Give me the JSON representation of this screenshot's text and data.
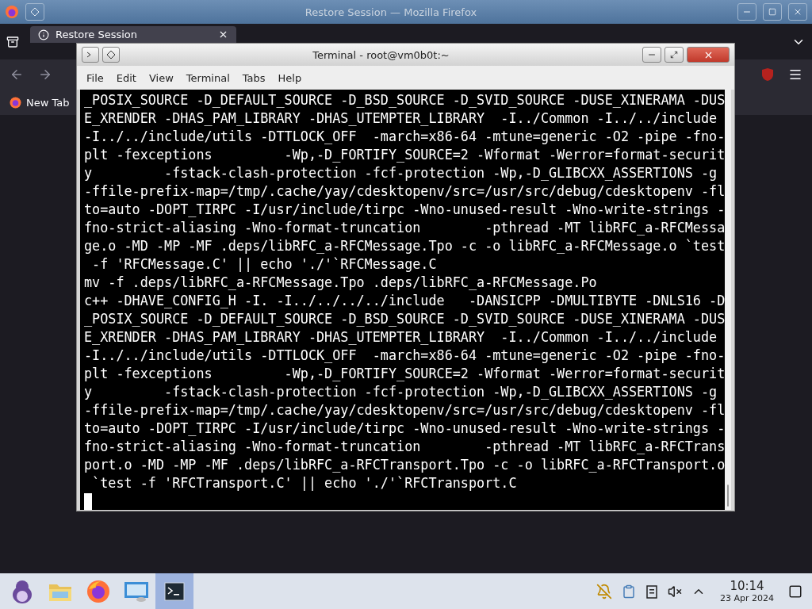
{
  "browser": {
    "title": "Restore Session — Mozilla Firefox",
    "tabs": [
      {
        "label": "Restore Session",
        "selected": true
      }
    ],
    "bookmarks": [
      "New Tab"
    ]
  },
  "terminal": {
    "title": "Terminal - root@vm0b0t:~",
    "menu": [
      "File",
      "Edit",
      "View",
      "Terminal",
      "Tabs",
      "Help"
    ],
    "lines": [
      "_POSIX_SOURCE -D_DEFAULT_SOURCE -D_BSD_SOURCE -D_SVID_SOURCE -DUSE_XINERAMA -DUS",
      "E_XRENDER -DHAS_PAM_LIBRARY -DHAS_UTEMPTER_LIBRARY  -I../Common -I../../include",
      "-I../../include/utils -DTTLOCK_OFF  -march=x86-64 -mtune=generic -O2 -pipe -fno-",
      "plt -fexceptions         -Wp,-D_FORTIFY_SOURCE=2 -Wformat -Werror=format-securit",
      "y         -fstack-clash-protection -fcf-protection -Wp,-D_GLIBCXX_ASSERTIONS -g",
      "-ffile-prefix-map=/tmp/.cache/yay/cdesktopenv/src=/usr/src/debug/cdesktopenv -fl",
      "to=auto -DOPT_TIRPC -I/usr/include/tirpc -Wno-unused-result -Wno-write-strings -",
      "fno-strict-aliasing -Wno-format-truncation        -pthread -MT libRFC_a-RFCMessa",
      "ge.o -MD -MP -MF .deps/libRFC_a-RFCMessage.Tpo -c -o libRFC_a-RFCMessage.o `test",
      " -f 'RFCMessage.C' || echo './'`RFCMessage.C",
      "mv -f .deps/libRFC_a-RFCMessage.Tpo .deps/libRFC_a-RFCMessage.Po",
      "c++ -DHAVE_CONFIG_H -I. -I../../../../include   -DANSICPP -DMULTIBYTE -DNLS16 -D",
      "_POSIX_SOURCE -D_DEFAULT_SOURCE -D_BSD_SOURCE -D_SVID_SOURCE -DUSE_XINERAMA -DUS",
      "E_XRENDER -DHAS_PAM_LIBRARY -DHAS_UTEMPTER_LIBRARY  -I../Common -I../../include",
      "-I../../include/utils -DTTLOCK_OFF  -march=x86-64 -mtune=generic -O2 -pipe -fno-",
      "plt -fexceptions         -Wp,-D_FORTIFY_SOURCE=2 -Wformat -Werror=format-securit",
      "y         -fstack-clash-protection -fcf-protection -Wp,-D_GLIBCXX_ASSERTIONS -g",
      "-ffile-prefix-map=/tmp/.cache/yay/cdesktopenv/src=/usr/src/debug/cdesktopenv -fl",
      "to=auto -DOPT_TIRPC -I/usr/include/tirpc -Wno-unused-result -Wno-write-strings -",
      "fno-strict-aliasing -Wno-format-truncation        -pthread -MT libRFC_a-RFCTrans",
      "port.o -MD -MP -MF .deps/libRFC_a-RFCTransport.Tpo -c -o libRFC_a-RFCTransport.o",
      " `test -f 'RFCTransport.C' || echo './'`RFCTransport.C"
    ]
  },
  "taskbar": {
    "apps": [
      {
        "kind": "mascot",
        "selected": false
      },
      {
        "kind": "folder",
        "selected": false
      },
      {
        "kind": "firefox",
        "selected": false
      },
      {
        "kind": "monitor",
        "selected": false
      },
      {
        "kind": "terminal",
        "selected": true
      }
    ],
    "time": "10:14",
    "date": "23 Apr 2024"
  }
}
